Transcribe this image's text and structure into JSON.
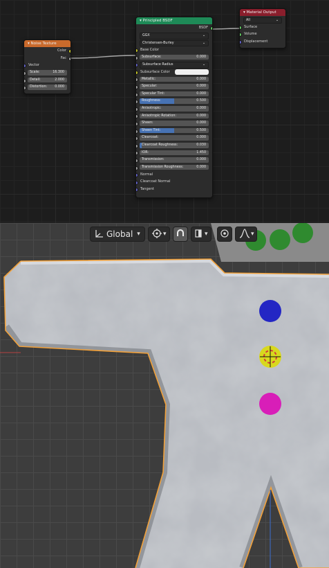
{
  "node_editor": {
    "noise_texture": {
      "title": "Noise Texture",
      "outputs": [
        "Color",
        "Fac"
      ],
      "vector_label": "Vector",
      "fields": [
        {
          "label": "Scale:",
          "value": "16.300"
        },
        {
          "label": "Detail:",
          "value": "2.000"
        },
        {
          "label": "Distortion:",
          "value": "0.000"
        }
      ]
    },
    "principled_bsdf": {
      "title": "Principled BSDF",
      "output": "BSDF",
      "distribution": "GGX",
      "subsurface_method": "Christensen-Burley",
      "base_color_label": "Base Color",
      "subsurface": {
        "label": "Subsurface:",
        "value": "0.000"
      },
      "subsurface_radius": "Subsurface Radius",
      "subsurface_color": "Subsurface Color",
      "sliders": [
        {
          "label": "Metallic:",
          "value": "0.000",
          "fill": 0
        },
        {
          "label": "Specular:",
          "value": "0.000",
          "fill": 0
        },
        {
          "label": "Specular Tint:",
          "value": "0.000",
          "fill": 0
        },
        {
          "label": "Roughness:",
          "value": "0.500",
          "fill": 0.5
        },
        {
          "label": "Anisotropic:",
          "value": "0.000",
          "fill": 0
        },
        {
          "label": "Anisotropic Rotation:",
          "value": "0.000",
          "fill": 0
        },
        {
          "label": "Sheen:",
          "value": "0.000",
          "fill": 0
        },
        {
          "label": "Sheen Tint:",
          "value": "0.500",
          "fill": 0.5
        },
        {
          "label": "Clearcoat:",
          "value": "0.000",
          "fill": 0
        },
        {
          "label": "Clearcoat Roughness:",
          "value": "0.030",
          "fill": 0.03
        },
        {
          "label": "IOR:",
          "value": "1.450",
          "fill": 0
        },
        {
          "label": "Transmission:",
          "value": "0.000",
          "fill": 0
        },
        {
          "label": "Transmission Roughness:",
          "value": "0.000",
          "fill": 0
        }
      ],
      "inputs_bottom": [
        "Normal",
        "Clearcoat Normal",
        "Tangent"
      ]
    },
    "material_output": {
      "title": "Material Output",
      "target": "All",
      "inputs": [
        "Surface",
        "Volume",
        "Displacement"
      ]
    }
  },
  "viewport": {
    "toolbar": {
      "orientation": "Global"
    }
  },
  "colors": {
    "texture_header": "#c96a2c",
    "shader_header": "#1e8a57",
    "output_header": "#8a1e2c",
    "slider_fill": "#4772b3",
    "selection_outline": "#f2a13a"
  }
}
